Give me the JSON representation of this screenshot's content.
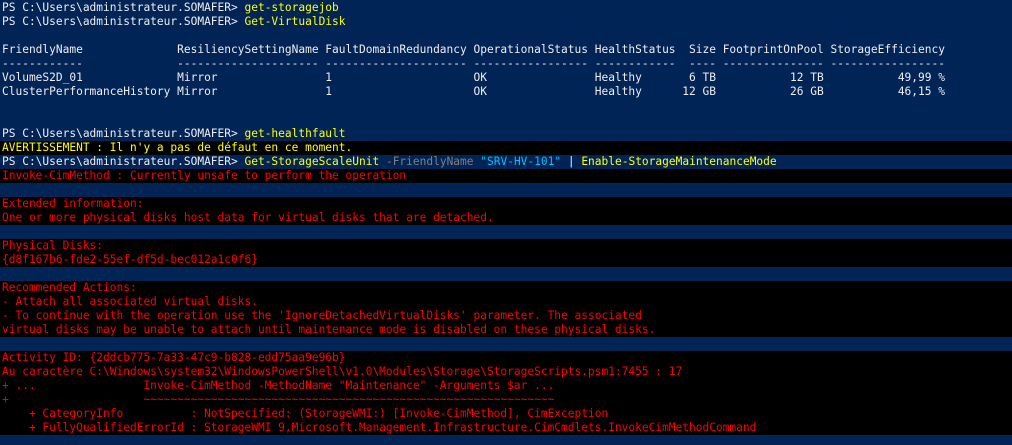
{
  "prompt": "PS C:\\Users\\administrateur.SOMAFER> ",
  "commands": {
    "c1": "get-storagejob",
    "c2": "Get-VirtualDisk",
    "c3": "get-healthfault",
    "c4_cmd": "Get-StorageScaleUnit",
    "c4_param": "-FriendlyName",
    "c4_value": "\"SRV-HV-101\"",
    "c4_pipe": " | ",
    "c4_cmd2": "Enable-StorageMaintenanceMode"
  },
  "table": {
    "header": "FriendlyName              ResiliencySettingName FaultDomainRedundancy OperationalStatus HealthStatus  Size FootprintOnPool StorageEfficiency",
    "divider": "------------              --------------------- --------------------- ----------------- ------------  ---- --------------- -----------------",
    "row1": "VolumeS2D_01              Mirror                1                     OK                Healthy       6 TB           12 TB           49,99 %",
    "row2": "ClusterPerformanceHistory Mirror                1                     OK                Healthy      12 GB           26 GB           46,15 %"
  },
  "warning": "AVERTISSEMENT : Il n'y a pas de défaut en ce moment.",
  "errors": {
    "e1": "Invoke-CimMethod : Currently unsafe to perform the operation",
    "e2": "Extended information:",
    "e3": "One or more physical disks host data for virtual disks that are detached.",
    "e4": "Physical Disks:",
    "e5": "{d8f167b6-fde2-55ef-df5d-bec012a1c0f6}",
    "e6": "Recommended Actions:",
    "e7": "- Attach all associated virtual disks.",
    "e8": "- To continue with the operation use the 'IgnoreDetachedVirtualDisks' parameter. The associated",
    "e9": "virtual disks may be unable to attach until maintenance mode is disabled on these physical disks.",
    "e10": "Activity ID: {2ddcb775-7a33-47c9-b828-edd75aa9e96b}",
    "e11": "Au caractère C:\\Windows\\system32\\WindowsPowerShell\\v1.0\\Modules\\Storage\\StorageScripts.psm1:7455 : 17",
    "e12": "+ ...                Invoke-CimMethod -MethodName \"Maintenance\" -Arguments $ar ...",
    "e13": "+                    ~~~~~~~~~~~~~~~~~~~~~~~~~~~~~~~~~~~~~~~~~~~~~~~~~~~~~~~~~~~~~",
    "e14": "    + CategoryInfo          : NotSpecified: (StorageWMI:) [Invoke-CimMethod], CimException",
    "e15": "    + FullyQualifiedErrorId : StorageWMI 9,Microsoft.Management.Infrastructure.CimCmdlets.InvokeCimMethodCommand"
  },
  "colors": {
    "background": "#012456",
    "command": "#ffff00",
    "error": "#ff0000",
    "string": "#00bfff",
    "parameter": "#7f7f7f"
  }
}
